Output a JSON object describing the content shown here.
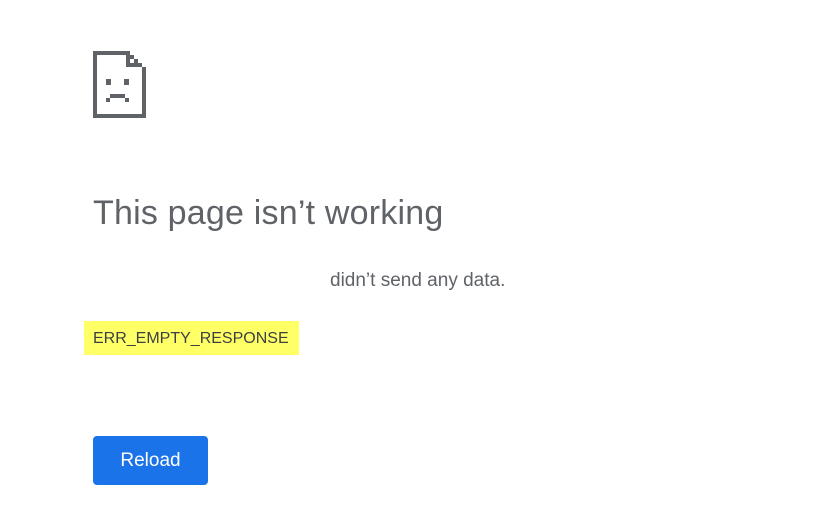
{
  "icon": "sad-page-icon",
  "title": "This page isn’t working",
  "message": {
    "host": "",
    "text": "didn’t send any data."
  },
  "error_code": "ERR_EMPTY_RESPONSE",
  "reload_label": "Reload",
  "colors": {
    "title_text": "#5f6368",
    "error_highlight": "#ffff66",
    "button_blue": "#1a73e8"
  }
}
